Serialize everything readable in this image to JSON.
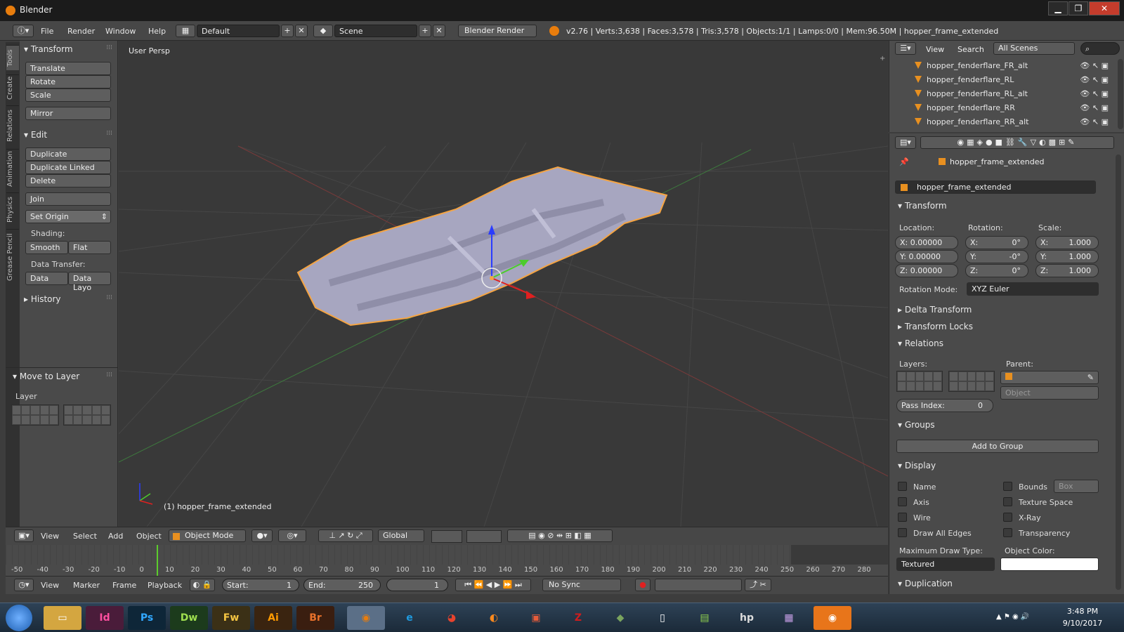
{
  "window": {
    "title": "Blender",
    "min": "▁",
    "max": "❐",
    "close": "✕"
  },
  "info": {
    "menus": [
      "File",
      "Render",
      "Window",
      "Help"
    ],
    "layout": "Default",
    "scene": "Scene",
    "engine": "Blender Render",
    "stats": "v2.76 | Verts:3,638 | Faces:3,578 | Tris:3,578 | Objects:1/1 | Lamps:0/0 | Mem:96.50M | hopper_frame_extended"
  },
  "tool_tabs": [
    "Tools",
    "Create",
    "Relations",
    "Animation",
    "Physics",
    "Grease Pencil"
  ],
  "toolshelf": {
    "transform_header": "Transform",
    "translate": "Translate",
    "rotate": "Rotate",
    "scale": "Scale",
    "mirror": "Mirror",
    "edit_header": "Edit",
    "duplicate": "Duplicate",
    "duplicate_linked": "Duplicate Linked",
    "delete": "Delete",
    "join": "Join",
    "set_origin": "Set Origin",
    "shading_label": "Shading:",
    "smooth": "Smooth",
    "flat": "Flat",
    "data_transfer_label": "Data Transfer:",
    "data": "Data",
    "data_layo": "Data Layo",
    "history_header": "History",
    "move_layer_header": "Move to Layer",
    "layer_label": "Layer"
  },
  "viewport": {
    "persp_label": "User Persp",
    "object_label": "(1) hopper_frame_extended"
  },
  "header3d": {
    "view": "View",
    "select": "Select",
    "add": "Add",
    "object": "Object",
    "mode": "Object Mode",
    "orientation": "Global"
  },
  "timeline": {
    "ticks": [
      "-50",
      "-40",
      "-30",
      "-20",
      "-10",
      "0",
      "10",
      "20",
      "30",
      "40",
      "50",
      "60",
      "70",
      "80",
      "90",
      "100",
      "110",
      "120",
      "130",
      "140",
      "150",
      "160",
      "170",
      "180",
      "190",
      "200",
      "210",
      "220",
      "230",
      "240",
      "250",
      "260",
      "270",
      "280"
    ],
    "current_frame": 1
  },
  "tlheader": {
    "view": "View",
    "marker": "Marker",
    "frame": "Frame",
    "playback": "Playback",
    "start": "Start:",
    "start_val": "1",
    "end": "End:",
    "end_val": "250",
    "frame_val": "1",
    "sync": "No Sync"
  },
  "outliner": {
    "view": "View",
    "search": "Search",
    "scenes": "All Scenes",
    "rows": [
      "hopper_fenderflare_FR_alt",
      "hopper_fenderflare_RL",
      "hopper_fenderflare_RL_alt",
      "hopper_fenderflare_RR",
      "hopper_fenderflare_RR_alt"
    ]
  },
  "properties": {
    "breadcrumb": "hopper_frame_extended",
    "object_name": "hopper_frame_extended",
    "transform": "Transform",
    "location": "Location:",
    "rotation": "Rotation:",
    "scale": "Scale:",
    "loc": [
      "X: 0.00000",
      "Y: 0.00000",
      "Z: 0.00000"
    ],
    "rot_axes": [
      "X:",
      "Y:",
      "Z:"
    ],
    "rot_vals": [
      "0°",
      "-0°",
      "0°"
    ],
    "scl_axes": [
      "X:",
      "Y:",
      "Z:"
    ],
    "scl_vals": [
      "1.000",
      "1.000",
      "1.000"
    ],
    "rotation_mode_label": "Rotation Mode:",
    "rotation_mode": "XYZ Euler",
    "delta": "Delta Transform",
    "locks": "Transform Locks",
    "relations": "Relations",
    "layers": "Layers:",
    "parent": "Parent:",
    "parent_type": "Object",
    "pass_index": "Pass Index:",
    "pass_val": "0",
    "groups": "Groups",
    "add_group": "Add to Group",
    "display": "Display",
    "name": "Name",
    "axis": "Axis",
    "wire": "Wire",
    "draw_edges": "Draw All Edges",
    "bounds": "Bounds",
    "bounds_type": "Box",
    "texture_space": "Texture Space",
    "xray": "X-Ray",
    "transparency": "Transparency",
    "max_draw_label": "Maximum Draw Type:",
    "max_draw": "Textured",
    "obj_color_label": "Object Color:",
    "duplication": "Duplication"
  },
  "taskbar": {
    "time": "3:48 PM",
    "date": "9/10/2017",
    "apps": [
      "Id",
      "Ps",
      "Dw",
      "Fw",
      "Ai",
      "Br"
    ]
  },
  "colors": {
    "accent": "#e87d0d",
    "selection": "#f5a442",
    "mesh": "#a7a6c0"
  }
}
